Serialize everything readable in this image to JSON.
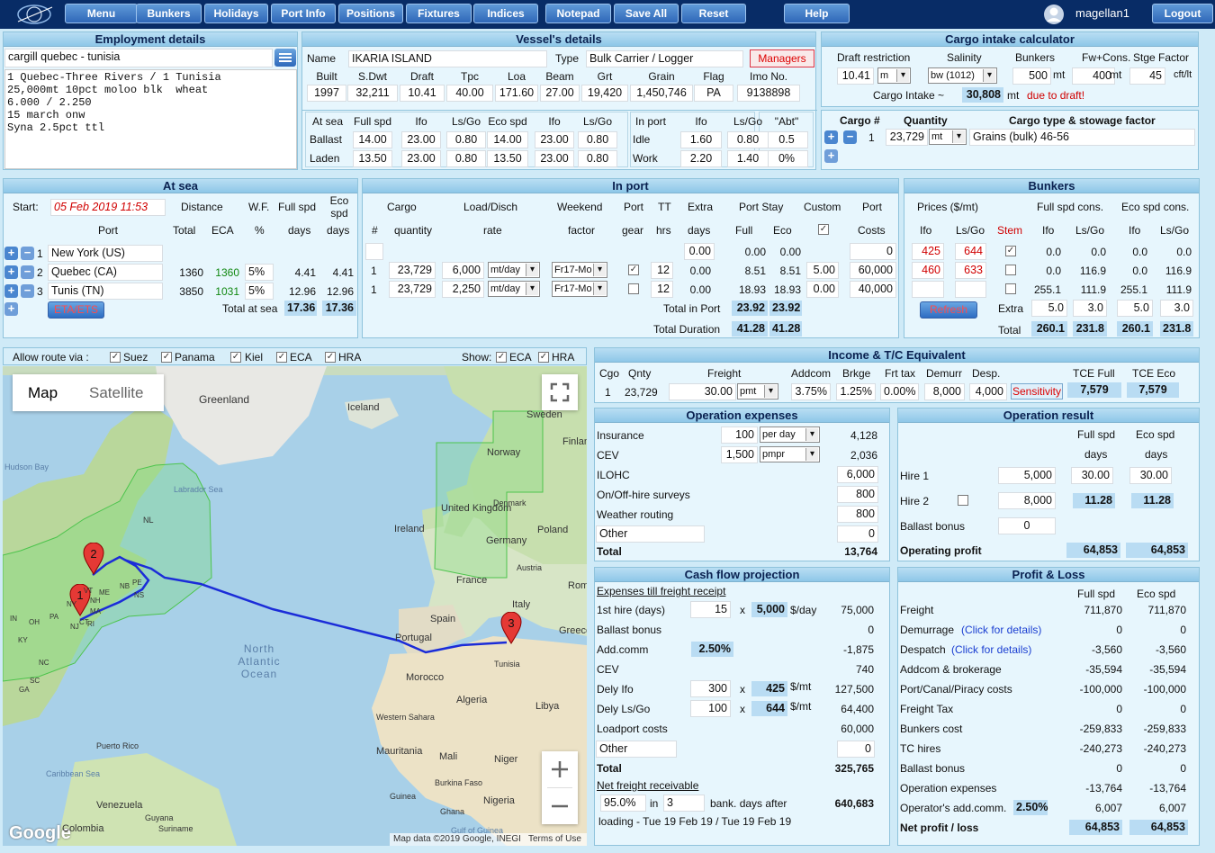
{
  "nav": {
    "menu": "Menu",
    "bunkers": "Bunkers",
    "holidays": "Holidays",
    "portinfo": "Port Info",
    "positions": "Positions",
    "fixtures": "Fixtures",
    "indices": "Indices",
    "notepad": "Notepad",
    "saveall": "Save All",
    "reset": "Reset",
    "help": "Help",
    "user": "magellan1",
    "logout": "Logout"
  },
  "employment": {
    "title": "Employment details",
    "name": "cargill quebec - tunisia",
    "notes": "1 Quebec-Three Rivers / 1 Tunisia\n25,000mt 10pct moloo blk  wheat\n6.000 / 2.250\n15 march onw\nSyna 2.5pct ttl"
  },
  "vessel": {
    "title": "Vessel's details",
    "name_label": "Name",
    "name": "IKARIA ISLAND",
    "type_label": "Type",
    "type": "Bulk Carrier / Logger",
    "managers": "Managers",
    "heads": [
      "Built",
      "S.Dwt",
      "Draft",
      "Tpc",
      "Loa",
      "Beam",
      "Grt",
      "Grain",
      "Flag",
      "Imo No."
    ],
    "vals": [
      "1997",
      "32,211",
      "10.41",
      "40.00",
      "171.60",
      "27.00",
      "19,420",
      "1,450,746",
      "PA",
      "9138898"
    ],
    "sea_heads": [
      "At sea",
      "Full spd",
      "Ifo",
      "Ls/Go",
      "Eco spd",
      "Ifo",
      "Ls/Go"
    ],
    "ballast": [
      "Ballast",
      "14.00",
      "23.00",
      "0.80",
      "14.00",
      "23.00",
      "0.80"
    ],
    "laden": [
      "Laden",
      "13.50",
      "23.00",
      "0.80",
      "13.50",
      "23.00",
      "0.80"
    ],
    "port_heads": [
      "In port",
      "Ifo",
      "Ls/Go"
    ],
    "idle": [
      "Idle",
      "1.60",
      "0.80"
    ],
    "work": [
      "Work",
      "2.20",
      "1.40"
    ],
    "abt": "\"Abt\"",
    "abt1": "0.5",
    "abt2": "0%"
  },
  "cargo_calc": {
    "title": "Cargo intake calculator",
    "draft_label": "Draft restriction",
    "draft": "10.41",
    "unit": "m",
    "salinity_label": "Salinity",
    "salinity": "bw (1012)",
    "bunkers_label": "Bunkers",
    "bunkers": "500",
    "mt1": "mt",
    "fw_label": "Fw+Cons.",
    "fw": "400",
    "mt2": "mt",
    "stge_label": "Stge Factor",
    "stge": "45",
    "cft": "cft/lt",
    "intake_label": "Cargo Intake ~",
    "intake": "30,808",
    "mt3": "mt",
    "due": "due to draft!"
  },
  "cargo_list": {
    "h_cargo": "Cargo #",
    "h_qty": "Quantity",
    "h_type": "Cargo type & stowage factor",
    "num": "1",
    "qty": "23,729",
    "unit": "mt",
    "type": "Grains (bulk)  46-56"
  },
  "atsea": {
    "title": "At sea",
    "start_label": "Start:",
    "start": "05 Feb 2019 11:53",
    "h_distance": "Distance",
    "h_wf": "W.F.",
    "h_full": "Full spd",
    "h_eco": "Eco spd",
    "h_port": "Port",
    "h_total": "Total",
    "h_eca": "ECA",
    "h_pct": "%",
    "h_days": "days",
    "h_days2": "days",
    "rows": [
      {
        "n": "1",
        "port": "New York (US)",
        "total": "",
        "eca": "",
        "wf": "",
        "full": "",
        "eco": ""
      },
      {
        "n": "2",
        "port": "Quebec (CA)",
        "total": "1360",
        "eca": "1360",
        "wf": "5%",
        "full": "4.41",
        "eco": "4.41"
      },
      {
        "n": "3",
        "port": "Tunis (TN)",
        "total": "3850",
        "eca": "1031",
        "wf": "5%",
        "full": "12.96",
        "eco": "12.96"
      }
    ],
    "eta_btn": "ETA/ETS",
    "total_label": "Total at sea",
    "total_full": "17.36",
    "total_eco": "17.36"
  },
  "inport": {
    "title": "In port",
    "h_cargo": "Cargo",
    "h_load": "Load/Disch",
    "h_weekend": "Weekend",
    "h_port": "Port",
    "h_tt": "TT",
    "h_extra": "Extra",
    "h_stay": "Port Stay",
    "h_custom": "Custom",
    "h_portc": "Port",
    "h_hash": "#",
    "h_qty": "quantity",
    "h_rate": "rate",
    "h_factor": "factor",
    "h_gear": "gear",
    "h_hrs": "hrs",
    "h_days": "days",
    "h_full": "Full",
    "h_eco": "Eco",
    "h_costs": "Costs",
    "row0": {
      "extra": "0.00",
      "full": "0.00",
      "eco": "0.00",
      "costs": "0"
    },
    "rows": [
      {
        "n": "1",
        "qty": "23,729",
        "rate": "6,000",
        "unit": "mt/day",
        "factor": "Fr17-Mo",
        "tt": "12",
        "extra": "0.00",
        "full": "8.51",
        "eco": "8.51",
        "custom": "5.00",
        "costs": "60,000"
      },
      {
        "n": "1",
        "qty": "23,729",
        "rate": "2,250",
        "unit": "mt/day",
        "factor": "Fr17-Mo",
        "tt": "12",
        "extra": "0.00",
        "full": "18.93",
        "eco": "18.93",
        "custom": "0.00",
        "costs": "40,000"
      }
    ],
    "total_label": "Total in Port",
    "total_full": "23.92",
    "total_eco": "23.92",
    "dur_label": "Total Duration",
    "dur_full": "41.28",
    "dur_eco": "41.28"
  },
  "bunkers": {
    "title": "Bunkers",
    "prices": "Prices ($/mt)",
    "full_cons": "Full spd cons.",
    "eco_cons": "Eco spd cons.",
    "h_ifo": "Ifo",
    "h_lsgo": "Ls/Go",
    "h_stem": "Stem",
    "rows": [
      {
        "ifo": "425",
        "lsgo": "644",
        "fi": "0.0",
        "fl": "0.0",
        "ei": "0.0",
        "el": "0.0"
      },
      {
        "ifo": "460",
        "lsgo": "633",
        "fi": "0.0",
        "fl": "116.9",
        "ei": "0.0",
        "el": "116.9"
      },
      {
        "ifo": "",
        "lsgo": "",
        "fi": "255.1",
        "fl": "111.9",
        "ei": "255.1",
        "el": "111.9"
      }
    ],
    "refresh": "Refresh",
    "extra_label": "Extra",
    "extra": [
      "5.0",
      "3.0",
      "5.0",
      "3.0"
    ],
    "total_label": "Total",
    "total": [
      "260.1",
      "231.8",
      "260.1",
      "231.8"
    ]
  },
  "route": {
    "allow": "Allow route via :",
    "suez": "Suez",
    "panama": "Panama",
    "kiel": "Kiel",
    "eca": "ECA",
    "hra": "HRA",
    "show": "Show:",
    "show_eca": "ECA",
    "show_hra": "HRA"
  },
  "map": {
    "map_tab": "Map",
    "sat_tab": "Satellite",
    "labels": [
      "Greenland",
      "Iceland",
      "Sweden",
      "Finland",
      "Norway",
      "Denmark",
      "United Kingdom",
      "Ireland",
      "Poland",
      "Germany",
      "Austria",
      "France",
      "Rom",
      "Italy",
      "Spain",
      "Portugal",
      "Greece",
      "Tunisia",
      "Morocco",
      "Algeria",
      "Libya",
      "Western Sahara",
      "Mauritania",
      "Mali",
      "Niger",
      "Burkina Faso",
      "Guinea",
      "Ghana",
      "Nigeria",
      "Gulf of Guinea",
      "Hudson Bay",
      "Labrador Sea",
      "North Atlantic Ocean",
      "Caribbean Sea",
      "Puerto Rico",
      "Venezuela",
      "Colombia",
      "Guyana",
      "Suriname",
      "NL",
      "PE",
      "NS",
      "NB",
      "ME",
      "NH",
      "MA",
      "CT",
      "RI",
      "NY",
      "PA",
      "OH",
      "KY",
      "IN",
      "NC",
      "GA",
      "SC",
      "NJ",
      "VT"
    ],
    "google": "Google",
    "attribution": "Map data ©2019 Google, INEGI",
    "terms": "Terms of Use",
    "m1": "1",
    "m2": "2",
    "m3": "3"
  },
  "income": {
    "title": "Income & T/C Equivalent",
    "h": [
      "Cgo",
      "Qnty",
      "Freight",
      "Addcom",
      "Brkge",
      "Frt tax",
      "Demurr",
      "Desp.",
      "TCE Full",
      "TCE Eco"
    ],
    "cgo": "1",
    "qty": "23,729",
    "freight": "30.00",
    "unit": "pmt",
    "addcom": "3.75%",
    "brkge": "1.25%",
    "frt": "0.00%",
    "dem": "8,000",
    "desp": "4,000",
    "sens": "Sensitivity",
    "tce_full": "7,579",
    "tce_eco": "7,579"
  },
  "opex": {
    "title": "Operation expenses",
    "ins_label": "Insurance",
    "ins_val": "100",
    "ins_unit": "per day",
    "ins_tot": "4,128",
    "cev_label": "CEV",
    "cev_val": "1,500",
    "cev_unit": "pmpr",
    "cev_tot": "2,036",
    "ilohc": "ILOHC",
    "ilohc_val": "6,000",
    "onoff": "On/Off-hire surveys",
    "onoff_val": "800",
    "wr": "Weather routing",
    "wr_val": "800",
    "other": "Other",
    "other_val": "0",
    "total": "Total",
    "total_val": "13,764"
  },
  "opres": {
    "title": "Operation result",
    "full": "Full spd",
    "eco": "Eco spd",
    "days": "days",
    "days2": "days",
    "hire1": "Hire 1",
    "hire1_val": "5,000",
    "hire1_full": "30.00",
    "hire1_eco": "30.00",
    "hire2": "Hire 2",
    "hire2_val": "8,000",
    "hire2_full": "11.28",
    "hire2_eco": "11.28",
    "bb": "Ballast bonus",
    "bb_val": "0",
    "op": "Operating profit",
    "op_full": "64,853",
    "op_eco": "64,853"
  },
  "cashflow": {
    "title": "Cash flow projection",
    "till": "Expenses till freight receipt",
    "hire_label": "1st hire (days)",
    "hire_days": "15",
    "x1": "x",
    "hire_rate": "5,000",
    "per": "$/day",
    "hire_tot": "75,000",
    "bb": "Ballast bonus",
    "bb_tot": "0",
    "addc": "Add.comm",
    "addc_pct": "2.50%",
    "addc_tot": "-1,875",
    "cev": "CEV",
    "cev_tot": "740",
    "dely_ifo": "Dely Ifo",
    "di_q": "300",
    "x2": "x",
    "di_p": "425",
    "smt1": "$/mt",
    "di_tot": "127,500",
    "dely_ls": "Dely Ls/Go",
    "dl_q": "100",
    "x3": "x",
    "dl_p": "644",
    "smt2": "$/mt",
    "dl_tot": "64,400",
    "lp": "Loadport costs",
    "lp_tot": "60,000",
    "other": "Other",
    "other_val": "0",
    "total": "Total",
    "total_val": "325,765",
    "net": "Net freight receivable",
    "net_pct": "95.0%",
    "in": "in",
    "net_days": "3",
    "bank": "bank. days after",
    "net_val": "640,683",
    "loading": "loading - Tue 19 Feb 19 / Tue 19 Feb 19"
  },
  "pl": {
    "title": "Profit & Loss",
    "full": "Full spd",
    "eco": "Eco spd",
    "rows": [
      [
        "Freight",
        "",
        "711,870",
        "711,870"
      ],
      [
        "Demurrage ",
        "(Click for details)",
        "0",
        "0"
      ],
      [
        "Despatch ",
        "(Click for details)",
        "-3,560",
        "-3,560"
      ],
      [
        "Addcom & brokerage",
        "",
        "-35,594",
        "-35,594"
      ],
      [
        "Port/Canal/Piracy costs",
        "",
        "-100,000",
        "-100,000"
      ],
      [
        "Freight Tax",
        "",
        "0",
        "0"
      ],
      [
        "Bunkers cost",
        "",
        "-259,833",
        "-259,833"
      ],
      [
        "TC hires",
        "",
        "-240,273",
        "-240,273"
      ],
      [
        "Ballast bonus",
        "",
        "0",
        "0"
      ],
      [
        "Operation expenses",
        "",
        "-13,764",
        "-13,764"
      ],
      [
        "Operator's add.comm.",
        "2.50%",
        "6,007",
        "6,007"
      ]
    ],
    "net": "Net profit / loss",
    "net_full": "64,853",
    "net_eco": "64,853"
  }
}
